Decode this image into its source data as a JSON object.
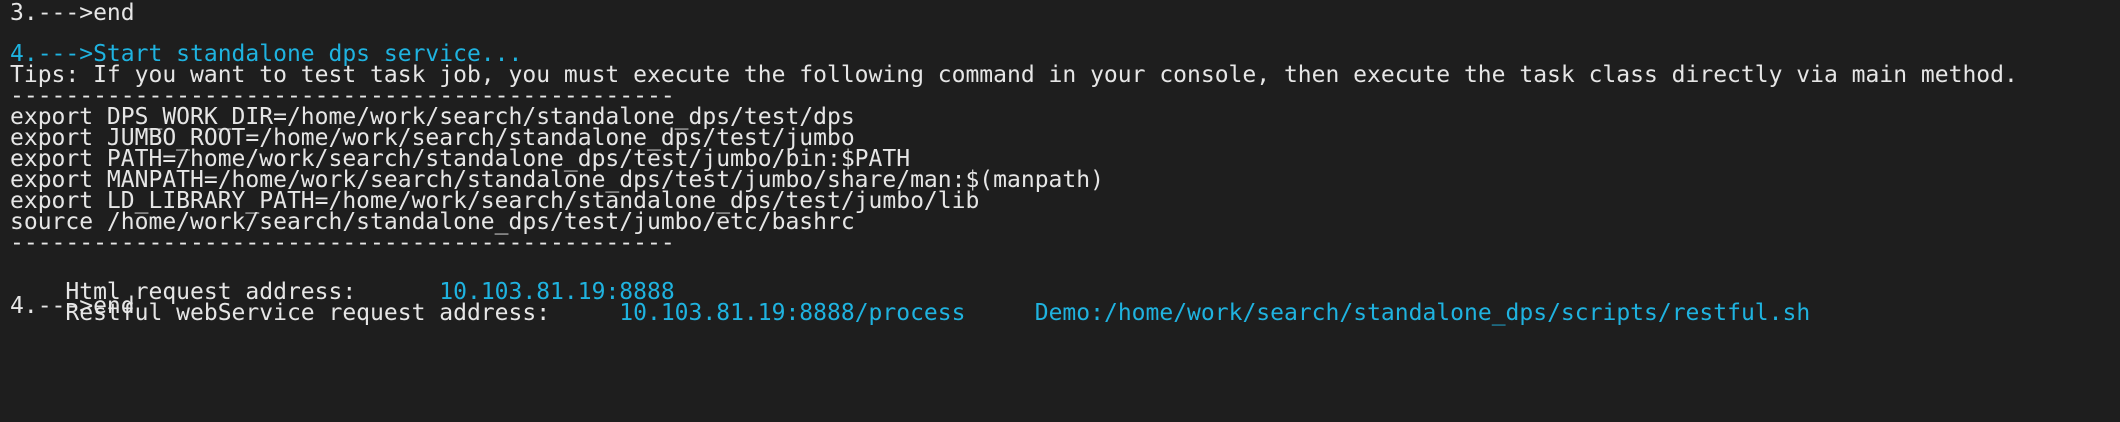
{
  "terminal": {
    "lines": {
      "step3_end": "3.--->end",
      "step4_start": "4.--->Start standalone dps service...",
      "tips": "Tips: If you want to test task job, you must execute the following command in your console, then execute the task class directly via main method.",
      "separator": "------------------------------------------------",
      "export_dps_work_dir": "export DPS_WORK_DIR=/home/work/search/standalone_dps/test/dps",
      "export_jumbo_root": "export JUMBO_ROOT=/home/work/search/standalone_dps/test/jumbo",
      "export_path": "export PATH=/home/work/search/standalone_dps/test/jumbo/bin:$PATH",
      "export_manpath": "export MANPATH=/home/work/search/standalone_dps/test/jumbo/share/man:$(manpath)",
      "export_ld_library_path": "export LD_LIBRARY_PATH=/home/work/search/standalone_dps/test/jumbo/lib",
      "source_bashrc": "source /home/work/search/standalone_dps/test/jumbo/etc/bashrc",
      "html_label": "Html request address:",
      "html_value": "10.103.81.19:8888",
      "restful_label": "Restful webService request address:",
      "restful_value": "10.103.81.19:8888/process",
      "restful_demo": "Demo:/home/work/search/standalone_dps/scripts/restful.sh",
      "step4_end": "4.--->end"
    }
  },
  "colors": {
    "background": "#1e1e1e",
    "text": "#e6e6e6",
    "accent_cyan": "#1fb3e0"
  }
}
